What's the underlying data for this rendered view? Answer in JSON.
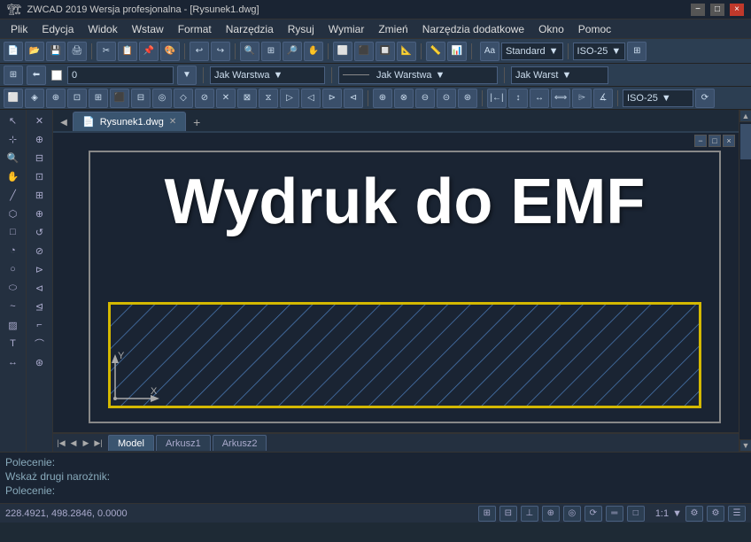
{
  "titlebar": {
    "title": "ZWCAD 2019 Wersja profesjonalna - [Rysunek1.dwg]",
    "icon": "Z",
    "min_label": "−",
    "max_label": "□",
    "close_label": "×"
  },
  "menubar": {
    "items": [
      "Plik",
      "Edycja",
      "Widok",
      "Wstaw",
      "Format",
      "Narzędzia",
      "Rysuj",
      "Wymiar",
      "Zmień",
      "Narzędzia dodatkowe",
      "Okno",
      "Pomoc"
    ]
  },
  "toolbar1": {
    "buttons": [
      "📁",
      "💾",
      "🖨",
      "✂",
      "📋",
      "↩",
      "↪",
      "🔍",
      "⬜",
      "⭕",
      "⬛",
      "🔲",
      "📐",
      "📏",
      "🔎",
      "🔎",
      "📊",
      "📈",
      "□",
      "□",
      "□",
      "□",
      "⚙",
      "⚙"
    ]
  },
  "toolbar2": {
    "layer": "0",
    "lineweight": "Jak Warstwa",
    "linetype": "Jak Warstwa",
    "linewidth": "Jak Warst",
    "standard_label": "Standard",
    "iso_label": "ISO-25"
  },
  "toolbar3": {
    "iso_label2": "ISO-25"
  },
  "drawing_tabs": {
    "active_tab": "Rysunek1.dwg",
    "tabs": [
      {
        "label": "Rysunek1.dwg",
        "active": true
      }
    ]
  },
  "canvas": {
    "main_text": "Wydruk do EMF",
    "hatch_color": "#d4b800"
  },
  "sheet_tabs": {
    "tabs": [
      {
        "label": "Model",
        "active": true
      },
      {
        "label": "Arkusz1",
        "active": false
      },
      {
        "label": "Arkusz2",
        "active": false
      }
    ]
  },
  "command_area": {
    "line1_label": "Polecenie:",
    "line1_value": "",
    "line2_label": "Wskaż drugi narożnik:",
    "line2_value": "",
    "line3_label": "Polecenie:",
    "line3_value": ""
  },
  "statusbar": {
    "coords": "228.4921, 498.2846, 0.0000",
    "scale": "1:1",
    "buttons": [
      "⊞",
      "○",
      "□",
      "△",
      "→",
      "⊕",
      "≡",
      "⟳",
      "⚙",
      "⚙"
    ]
  }
}
